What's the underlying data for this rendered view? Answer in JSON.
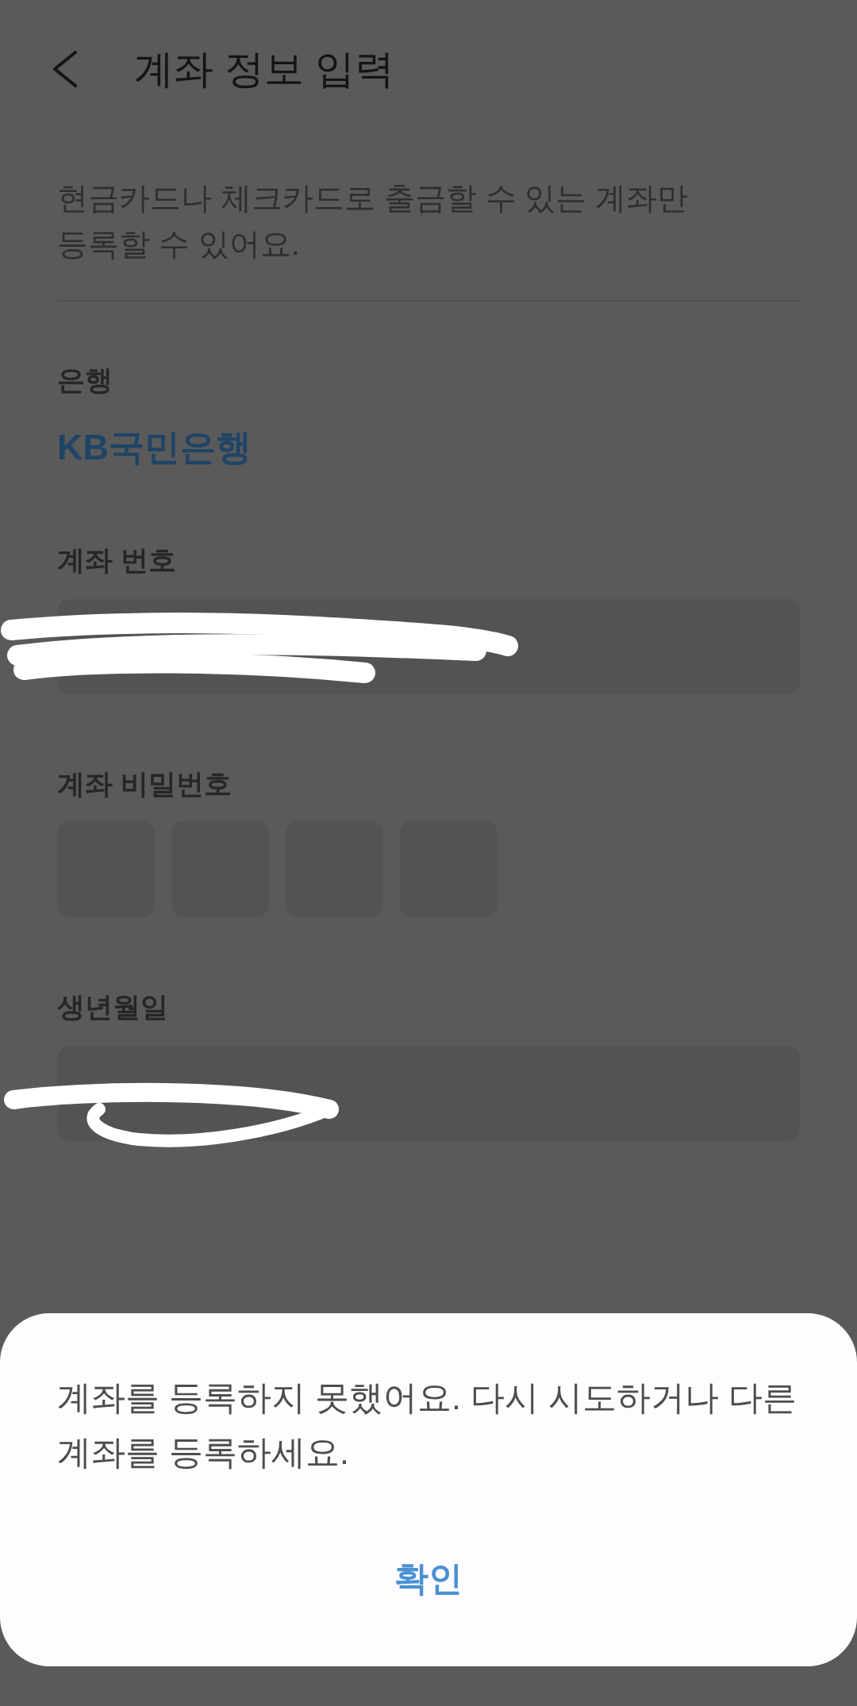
{
  "header": {
    "title": "계좌 정보 입력"
  },
  "notice": "현금카드나 체크카드로 출금할 수 있는 계좌만\n등록할 수 있어요.",
  "fields": [
    {
      "kind": "text",
      "label": "은행",
      "value": "KB국민은행"
    },
    {
      "kind": "input",
      "label": "계좌 번호",
      "redacted": true
    },
    {
      "kind": "pin",
      "label": "계좌 비밀번호",
      "digits": [
        {
          "filled": false
        },
        {
          "filled": false
        },
        {
          "filled": false
        },
        {
          "filled": false
        }
      ]
    },
    {
      "kind": "input",
      "label": "생년월일",
      "redacted": true
    }
  ],
  "dialog": {
    "message": "계좌를 등록하지 못했어요. 다시 시도하거나 다른\n계좌를 등록하세요.",
    "buttons": [
      "확인"
    ]
  }
}
